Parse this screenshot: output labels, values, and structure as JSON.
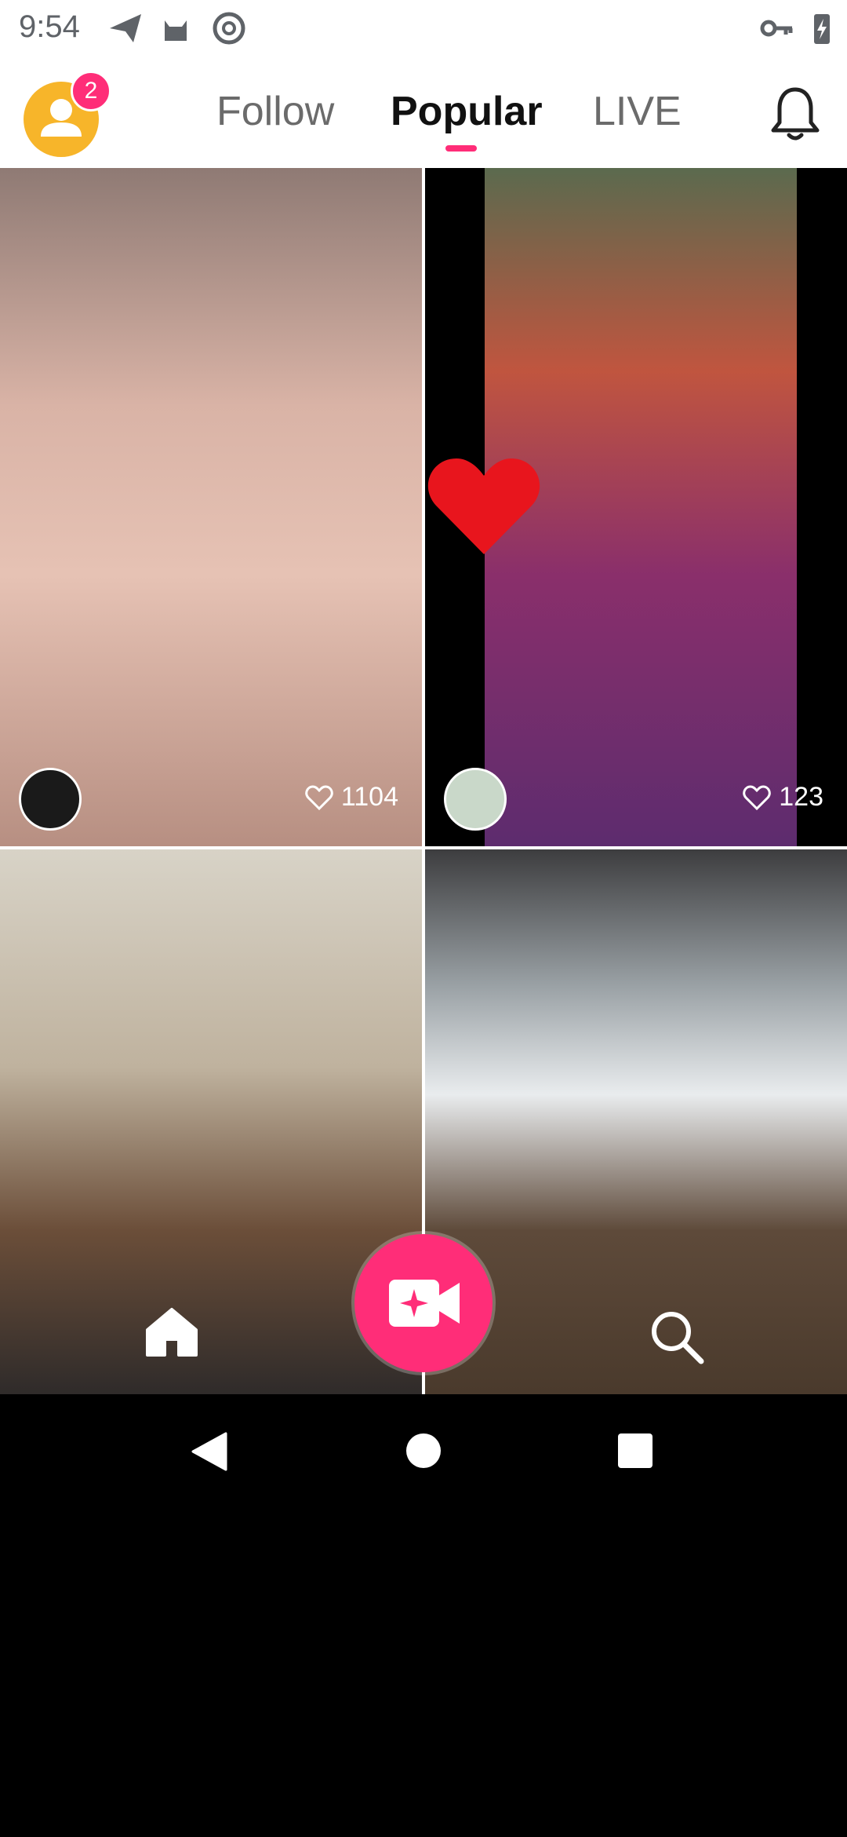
{
  "status_bar": {
    "time": "9:54"
  },
  "header": {
    "notification_badge": "2",
    "tabs": [
      {
        "label": "Follow",
        "selected": false
      },
      {
        "label": "Popular",
        "selected": true
      },
      {
        "label": "LIVE",
        "selected": false
      }
    ],
    "accent_color": "#ff2d78"
  },
  "feed": {
    "tiles": [
      {
        "likes": "1104"
      },
      {
        "likes": "123"
      },
      {
        "likes": ""
      },
      {
        "likes": ""
      }
    ]
  },
  "bottom_nav": {
    "home_icon": "home-icon",
    "record_icon": "video-camera-icon",
    "search_icon": "search-icon"
  }
}
